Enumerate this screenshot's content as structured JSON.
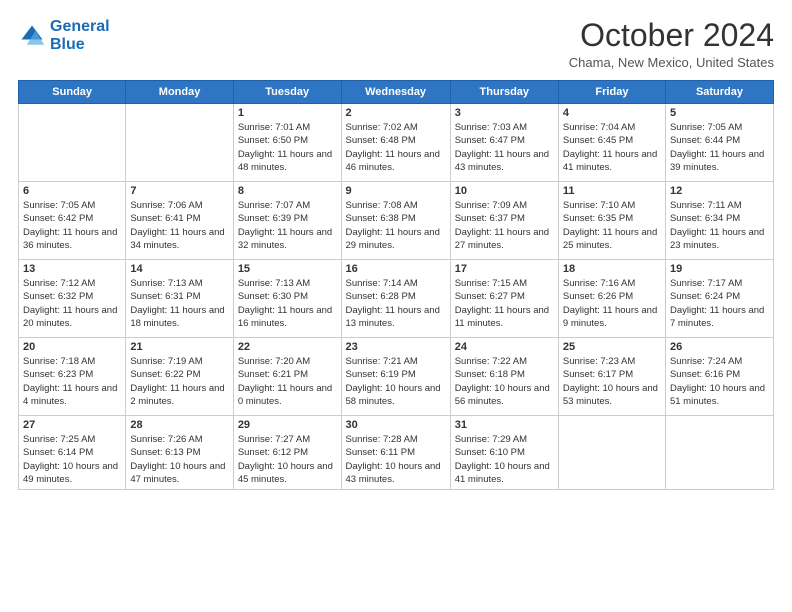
{
  "logo": {
    "line1": "General",
    "line2": "Blue"
  },
  "title": "October 2024",
  "location": "Chama, New Mexico, United States",
  "weekdays": [
    "Sunday",
    "Monday",
    "Tuesday",
    "Wednesday",
    "Thursday",
    "Friday",
    "Saturday"
  ],
  "weeks": [
    [
      {
        "day": "",
        "sunrise": "",
        "sunset": "",
        "daylight": ""
      },
      {
        "day": "",
        "sunrise": "",
        "sunset": "",
        "daylight": ""
      },
      {
        "day": "1",
        "sunrise": "Sunrise: 7:01 AM",
        "sunset": "Sunset: 6:50 PM",
        "daylight": "Daylight: 11 hours and 48 minutes."
      },
      {
        "day": "2",
        "sunrise": "Sunrise: 7:02 AM",
        "sunset": "Sunset: 6:48 PM",
        "daylight": "Daylight: 11 hours and 46 minutes."
      },
      {
        "day": "3",
        "sunrise": "Sunrise: 7:03 AM",
        "sunset": "Sunset: 6:47 PM",
        "daylight": "Daylight: 11 hours and 43 minutes."
      },
      {
        "day": "4",
        "sunrise": "Sunrise: 7:04 AM",
        "sunset": "Sunset: 6:45 PM",
        "daylight": "Daylight: 11 hours and 41 minutes."
      },
      {
        "day": "5",
        "sunrise": "Sunrise: 7:05 AM",
        "sunset": "Sunset: 6:44 PM",
        "daylight": "Daylight: 11 hours and 39 minutes."
      }
    ],
    [
      {
        "day": "6",
        "sunrise": "Sunrise: 7:05 AM",
        "sunset": "Sunset: 6:42 PM",
        "daylight": "Daylight: 11 hours and 36 minutes."
      },
      {
        "day": "7",
        "sunrise": "Sunrise: 7:06 AM",
        "sunset": "Sunset: 6:41 PM",
        "daylight": "Daylight: 11 hours and 34 minutes."
      },
      {
        "day": "8",
        "sunrise": "Sunrise: 7:07 AM",
        "sunset": "Sunset: 6:39 PM",
        "daylight": "Daylight: 11 hours and 32 minutes."
      },
      {
        "day": "9",
        "sunrise": "Sunrise: 7:08 AM",
        "sunset": "Sunset: 6:38 PM",
        "daylight": "Daylight: 11 hours and 29 minutes."
      },
      {
        "day": "10",
        "sunrise": "Sunrise: 7:09 AM",
        "sunset": "Sunset: 6:37 PM",
        "daylight": "Daylight: 11 hours and 27 minutes."
      },
      {
        "day": "11",
        "sunrise": "Sunrise: 7:10 AM",
        "sunset": "Sunset: 6:35 PM",
        "daylight": "Daylight: 11 hours and 25 minutes."
      },
      {
        "day": "12",
        "sunrise": "Sunrise: 7:11 AM",
        "sunset": "Sunset: 6:34 PM",
        "daylight": "Daylight: 11 hours and 23 minutes."
      }
    ],
    [
      {
        "day": "13",
        "sunrise": "Sunrise: 7:12 AM",
        "sunset": "Sunset: 6:32 PM",
        "daylight": "Daylight: 11 hours and 20 minutes."
      },
      {
        "day": "14",
        "sunrise": "Sunrise: 7:13 AM",
        "sunset": "Sunset: 6:31 PM",
        "daylight": "Daylight: 11 hours and 18 minutes."
      },
      {
        "day": "15",
        "sunrise": "Sunrise: 7:13 AM",
        "sunset": "Sunset: 6:30 PM",
        "daylight": "Daylight: 11 hours and 16 minutes."
      },
      {
        "day": "16",
        "sunrise": "Sunrise: 7:14 AM",
        "sunset": "Sunset: 6:28 PM",
        "daylight": "Daylight: 11 hours and 13 minutes."
      },
      {
        "day": "17",
        "sunrise": "Sunrise: 7:15 AM",
        "sunset": "Sunset: 6:27 PM",
        "daylight": "Daylight: 11 hours and 11 minutes."
      },
      {
        "day": "18",
        "sunrise": "Sunrise: 7:16 AM",
        "sunset": "Sunset: 6:26 PM",
        "daylight": "Daylight: 11 hours and 9 minutes."
      },
      {
        "day": "19",
        "sunrise": "Sunrise: 7:17 AM",
        "sunset": "Sunset: 6:24 PM",
        "daylight": "Daylight: 11 hours and 7 minutes."
      }
    ],
    [
      {
        "day": "20",
        "sunrise": "Sunrise: 7:18 AM",
        "sunset": "Sunset: 6:23 PM",
        "daylight": "Daylight: 11 hours and 4 minutes."
      },
      {
        "day": "21",
        "sunrise": "Sunrise: 7:19 AM",
        "sunset": "Sunset: 6:22 PM",
        "daylight": "Daylight: 11 hours and 2 minutes."
      },
      {
        "day": "22",
        "sunrise": "Sunrise: 7:20 AM",
        "sunset": "Sunset: 6:21 PM",
        "daylight": "Daylight: 11 hours and 0 minutes."
      },
      {
        "day": "23",
        "sunrise": "Sunrise: 7:21 AM",
        "sunset": "Sunset: 6:19 PM",
        "daylight": "Daylight: 10 hours and 58 minutes."
      },
      {
        "day": "24",
        "sunrise": "Sunrise: 7:22 AM",
        "sunset": "Sunset: 6:18 PM",
        "daylight": "Daylight: 10 hours and 56 minutes."
      },
      {
        "day": "25",
        "sunrise": "Sunrise: 7:23 AM",
        "sunset": "Sunset: 6:17 PM",
        "daylight": "Daylight: 10 hours and 53 minutes."
      },
      {
        "day": "26",
        "sunrise": "Sunrise: 7:24 AM",
        "sunset": "Sunset: 6:16 PM",
        "daylight": "Daylight: 10 hours and 51 minutes."
      }
    ],
    [
      {
        "day": "27",
        "sunrise": "Sunrise: 7:25 AM",
        "sunset": "Sunset: 6:14 PM",
        "daylight": "Daylight: 10 hours and 49 minutes."
      },
      {
        "day": "28",
        "sunrise": "Sunrise: 7:26 AM",
        "sunset": "Sunset: 6:13 PM",
        "daylight": "Daylight: 10 hours and 47 minutes."
      },
      {
        "day": "29",
        "sunrise": "Sunrise: 7:27 AM",
        "sunset": "Sunset: 6:12 PM",
        "daylight": "Daylight: 10 hours and 45 minutes."
      },
      {
        "day": "30",
        "sunrise": "Sunrise: 7:28 AM",
        "sunset": "Sunset: 6:11 PM",
        "daylight": "Daylight: 10 hours and 43 minutes."
      },
      {
        "day": "31",
        "sunrise": "Sunrise: 7:29 AM",
        "sunset": "Sunset: 6:10 PM",
        "daylight": "Daylight: 10 hours and 41 minutes."
      },
      {
        "day": "",
        "sunrise": "",
        "sunset": "",
        "daylight": ""
      },
      {
        "day": "",
        "sunrise": "",
        "sunset": "",
        "daylight": ""
      }
    ]
  ]
}
